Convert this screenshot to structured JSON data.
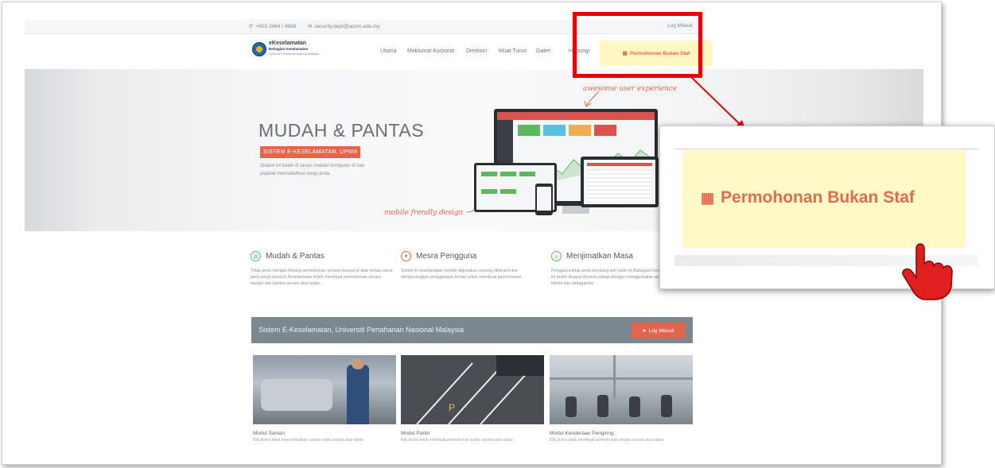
{
  "topbar": {
    "phone": "+603 3464 / 4888",
    "email": "security.dept@upnm.edu.my",
    "login_link": "Log Masuk"
  },
  "logo": {
    "line1": "eKeselamatan",
    "line2": "Bahagian Keselamatan",
    "line3": "Universiti Pertahanan Nasional Malaysia"
  },
  "nav": {
    "items": [
      "Utama",
      "Maklumat Korporat",
      "Direktori",
      "Muat Turun",
      "Galeri",
      "Hubungi"
    ],
    "non_staff": "Permohonan Bukan Staf"
  },
  "hero": {
    "title": "MUDAH & PANTAS",
    "badge": "SISTEM E-KESELAMATAN, UPNM",
    "desc": "Sistem ini boleh di akses melalui komputer di luar pejabat memudahkan kerja anda.",
    "note_top": "awesome user experience",
    "note_bottom": "mobile frendly design"
  },
  "features": [
    {
      "title": "Mudah & Pantas",
      "body": "Tidak perlu mengisi borang permohonan secara manual di atas kertas cuma perlu pergi portal E-Keselamatan boleh membuat permohonan secara mudah dan pantas secara atas talian."
    },
    {
      "title": "Mesra Pengguna",
      "body": "Sistem E-keselamatan mudah digunakan senang difahami dan mengurangkan penggunaan kertas untuk membuat permohonan."
    },
    {
      "title": "Menjimatkan Masa",
      "body": "Pengguna tidak perlu berulang kali hadir ke Bahagian Keselamatan. Sistem ini boleh dicapai dimana sahaja dengan menggunakan aplikasi telefon bimbit dan sebagainya."
    }
  ],
  "banner": {
    "text": "Sistem E-Keselamatan, Universiti Pertahanan Nasional Malaysia",
    "login": "Log Masuk"
  },
  "modules": [
    {
      "title": "Modul Saman",
      "desc": "Klik disini untuk menyelesaikan saman anda secara atas talian."
    },
    {
      "title": "Modul Parkir",
      "desc": "Klik disini untuk membuat permohonan parkir secara atas talian."
    },
    {
      "title": "Modul Kenderaan Pengiring",
      "desc": "Klik disini untuk membuat permohonan iringan secara atas talian."
    }
  ],
  "zoom": {
    "label": "Permohonan Bukan Staf"
  },
  "colors": {
    "accent": "#e2654d",
    "highlight": "#e60000",
    "yellow": "#fff7c2",
    "banner": "#7b8791"
  }
}
